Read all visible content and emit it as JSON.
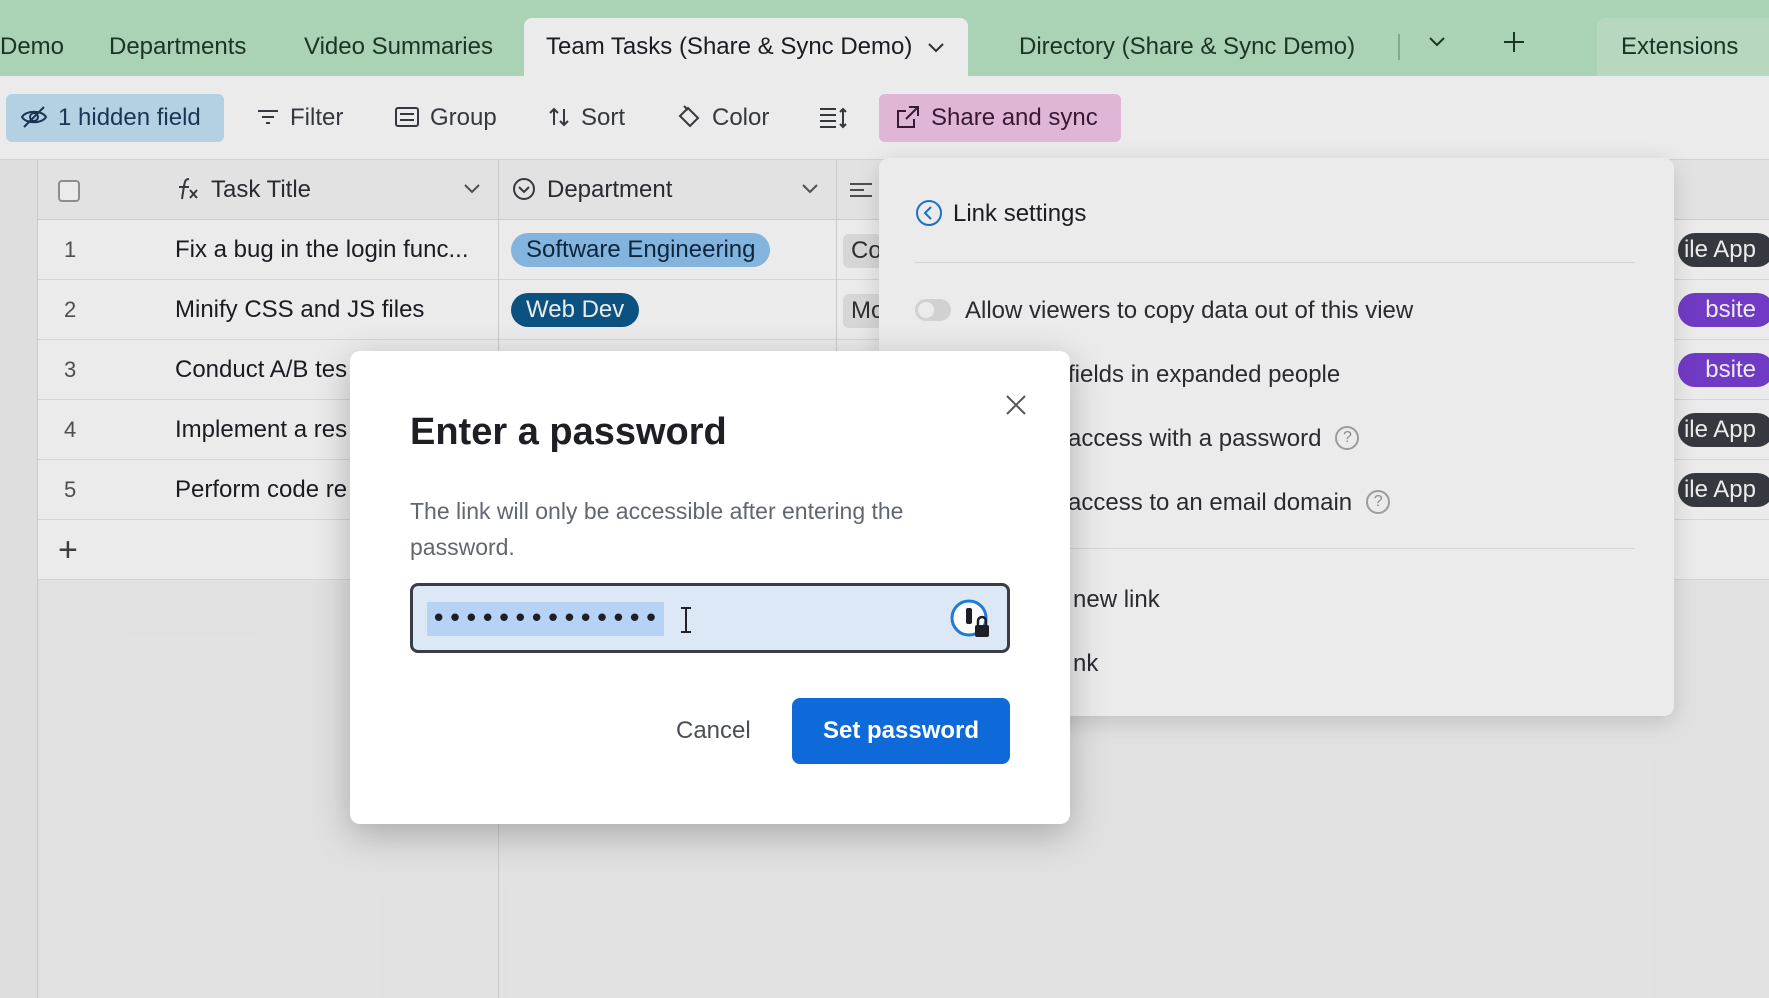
{
  "tabs": {
    "items": [
      "Demo",
      "Departments",
      "Video Summaries",
      "Team Tasks (Share & Sync Demo)",
      "Directory (Share & Sync Demo)"
    ],
    "extensions_label": "Extensions"
  },
  "toolbar": {
    "hidden_fields": "1 hidden field",
    "filter": "Filter",
    "group": "Group",
    "sort": "Sort",
    "color": "Color",
    "share": "Share and sync"
  },
  "grid": {
    "columns": [
      "Task Title",
      "Department"
    ],
    "rows": [
      {
        "num": "1",
        "title": "Fix a bug in the login func...",
        "dept": "Software Engineering",
        "c": "Co",
        "right": "ile App"
      },
      {
        "num": "2",
        "title": "Minify CSS and JS files",
        "dept": "Web Dev",
        "c": "Mo",
        "right": "bsite"
      },
      {
        "num": "3",
        "title": "Conduct A/B tes",
        "dept": "",
        "c": "",
        "right": "bsite"
      },
      {
        "num": "4",
        "title": "Implement a res",
        "dept": "",
        "c": "",
        "right": "ile App"
      },
      {
        "num": "5",
        "title": "Perform code re",
        "dept": "",
        "c": "",
        "right": "ile App"
      }
    ],
    "add_row": "+"
  },
  "share_panel": {
    "title": "Link settings",
    "copy_toggle": "Allow viewers to copy data out of this view",
    "item_fields": "fields in expanded people",
    "item_password": "access with a password",
    "item_email": "access to an email domain",
    "item_newlink": "new link",
    "item_link": "nk"
  },
  "modal": {
    "title": "Enter a password",
    "description": "The link will only be accessible after entering the password.",
    "password_mask": "••••••••••••••",
    "cancel": "Cancel",
    "submit": "Set password"
  },
  "colors": {
    "tabbar": "#b9e4c4",
    "accent_blue": "#0d6ad8",
    "share_pink": "#f3c6ea",
    "hidden_blue": "#c4e3f8"
  }
}
